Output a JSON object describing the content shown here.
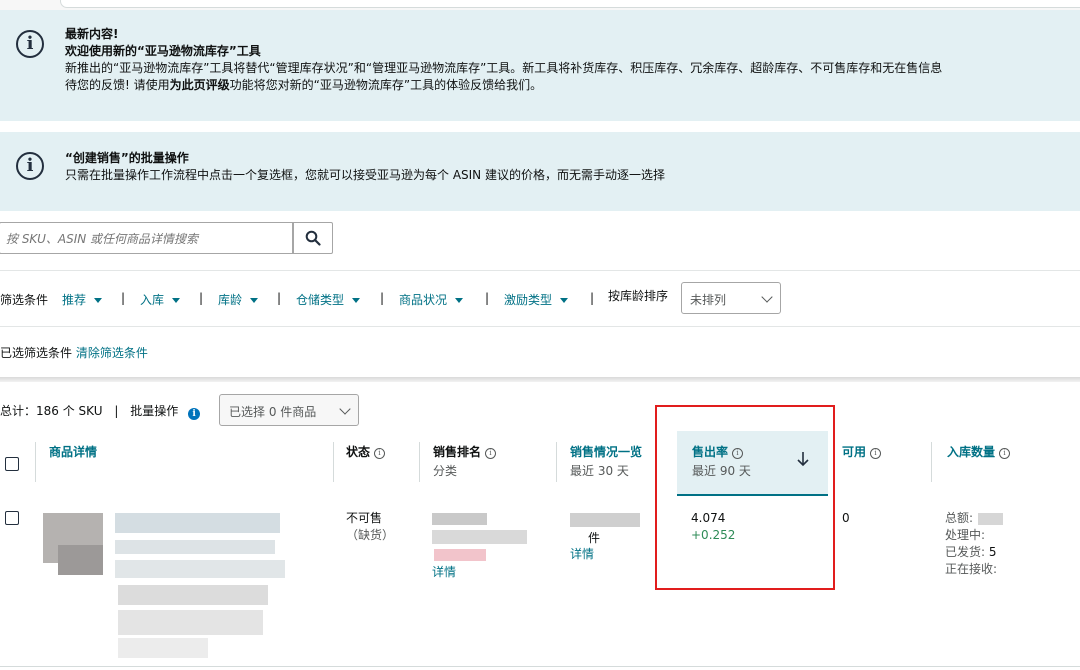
{
  "alerts": [
    {
      "title": "最新内容!",
      "subtitle": "欢迎使用新的“亚马逊物流库存”工具",
      "line1": "新推出的“亚马逊物流库存”工具将替代“管理库存状况”和“管理亚马逊物流库存”工具。新工具将补货库存、积压库存、冗余库存、超龄库存、不可售库存和无在售信息",
      "line2_a": "待您的反馈!  请使用",
      "line2_bold": "为此页评级",
      "line2_b": "功能将您对新的“亚马逊物流库存”工具的体验反馈给我们。"
    },
    {
      "title": "“创建销售”的批量操作",
      "line1": "只需在批量操作工作流程中点击一个复选框，您就可以接受亚马逊为每个 ASIN 建议的价格，而无需手动逐一选择"
    }
  ],
  "search": {
    "placeholder": "按 SKU、ASIN 或任何商品详情搜索"
  },
  "filters": {
    "label": "筛选条件",
    "items": [
      "推荐",
      "入库",
      "库龄",
      "仓储类型",
      "商品状况",
      "激励类型"
    ],
    "sort_label": "按库龄排序",
    "sort_value": "未排列"
  },
  "selected_filters": {
    "label": "已选筛选条件",
    "clear": "清除筛选条件"
  },
  "summary": {
    "total": "总计：186 个 SKU",
    "bulk_label": "批量操作",
    "bulk_select": "已选择 0 件商品"
  },
  "columns": {
    "product": "商品详情",
    "status": "状态",
    "sales_rank": "销售排名",
    "sales_rank_sub": "分类",
    "sales_overview": "销售情况一览",
    "sales_overview_sub": "最近 30 天",
    "sell_through": "售出率",
    "sell_through_sub": "最近 90 天",
    "available": "可用",
    "inbound": "入库数量"
  },
  "row": {
    "status_line1": "不可售",
    "status_line2": "（缺货）",
    "rank_link": "详情",
    "sales_unit": "件",
    "sales_link": "详情",
    "sell_through_value": "4.074",
    "sell_through_delta": "+0.252",
    "available": "0",
    "inbound": [
      "总额:",
      "处理中:",
      "已发货:",
      "正在接收:"
    ],
    "inbound_partial": "5"
  },
  "colors": {
    "accent": "#007185",
    "alert_bg": "#e3f0f3",
    "highlight": "#e11d1d",
    "positive": "#2e8b57"
  }
}
